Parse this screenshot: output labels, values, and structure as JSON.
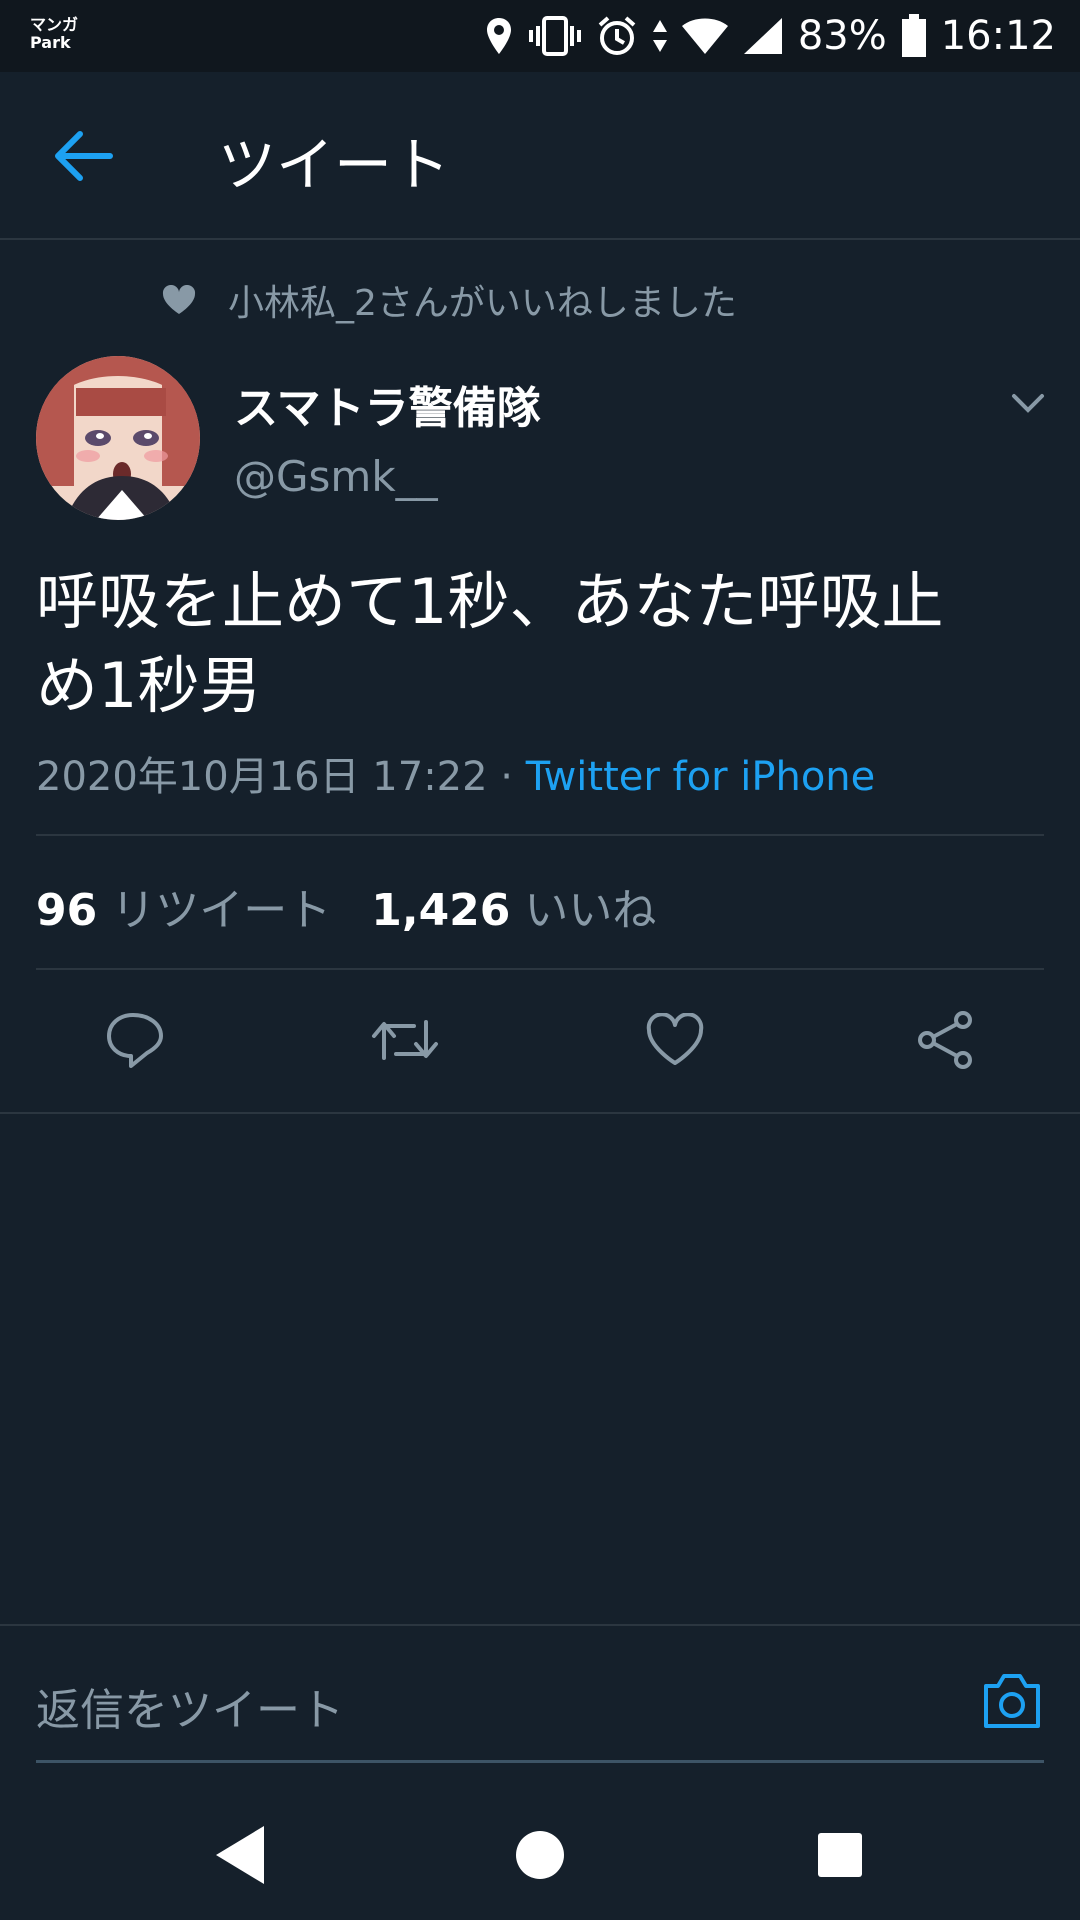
{
  "status_bar": {
    "app_logo_line1": "マンガ",
    "app_logo_line2": "Park",
    "battery": "83%",
    "time": "16:12"
  },
  "app_bar": {
    "title": "ツイート"
  },
  "tweet": {
    "liked_by": "小林私_2さんがいいねしました",
    "display_name": "スマトラ警備隊",
    "handle": "@Gsmk__",
    "text_line1": "呼吸を止めて1秒、あなた呼吸止",
    "text_line2": "め1秒男",
    "timestamp": "2020年10月16日 17:22",
    "separator": " · ",
    "source": "Twitter for iPhone",
    "retweet_count": "96",
    "retweet_label": "リツイート",
    "like_count": "1,426",
    "like_label": "いいね"
  },
  "reply": {
    "placeholder": "返信をツイート"
  },
  "colors": {
    "background": "#15202b",
    "accent": "#1da1f2",
    "secondary_text": "#8899a6"
  }
}
